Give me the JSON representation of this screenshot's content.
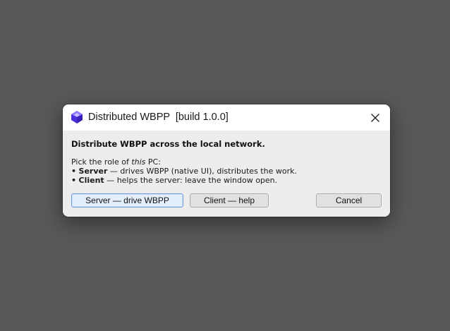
{
  "window": {
    "title": "Distributed WBPP  [build 1.0.0]",
    "icon": "purple-gem-icon",
    "close_icon": "close-icon"
  },
  "content": {
    "heading": "Distribute WBPP across the local network.",
    "intro_prefix": "Pick the role of ",
    "intro_emphasis": "this",
    "intro_suffix": " PC:",
    "bullet": "•",
    "server_term": "Server",
    "server_desc": " — drives WBPP (native UI), distributes the work.",
    "client_term": "Client",
    "client_desc": " — helps the server: leave the window open."
  },
  "buttons": {
    "server": "Server — drive WBPP",
    "client": "Client — help",
    "cancel": "Cancel"
  },
  "colors": {
    "backdrop": "#585858",
    "icon_accent": "#5b3fe0",
    "default_button_border": "#6f9be3"
  }
}
